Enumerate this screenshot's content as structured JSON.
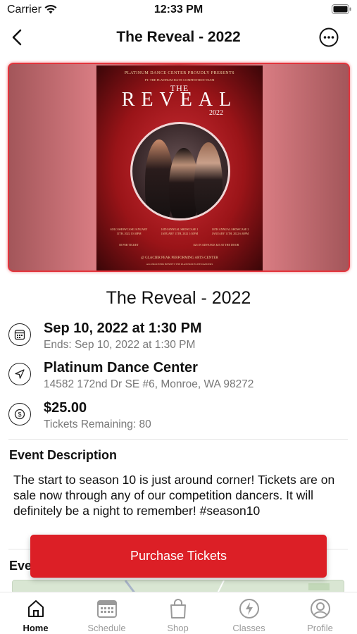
{
  "status_bar": {
    "carrier": "Carrier",
    "time": "12:33 PM"
  },
  "nav": {
    "title": "The Reveal - 2022"
  },
  "poster": {
    "header": "PLATINUM DANCE CENTER PROUDLY PRESENTS",
    "subheader": "PT. THE PLATINUM ELITE COMPETITION TEAM",
    "title_the": "THE",
    "title_main": "REVEAL",
    "title_year": "2022",
    "info_left": "SOLO SHOWCASE JANUARY 11TH, 2022 10:30PM",
    "info_center": "16TH ANNUAL SHOWCASE 1 JANUARY 11TH, 2022 1:30PM",
    "info_right": "16TH ANNUAL SHOWCASE 2 JANUARY 11TH, 2022 6:30PM",
    "info_price_left": "$5 PER TICKET",
    "info_price_right": "$25 IN ADVANCE $25 AT THE DOOR",
    "footer_main": "@ GLACIER PEAK PERFORMING ARTS CENTER",
    "footer_sub": "ALL PROCEEDS BENEFIT THE PLATINUM ELITE DANCERS"
  },
  "event": {
    "title": "The Reveal - 2022",
    "date_main": "Sep 10, 2022 at 1:30 PM",
    "date_sub": "Ends: Sep 10, 2022 at 1:30 PM",
    "location_main": "Platinum Dance Center",
    "location_sub": "14582 172nd Dr SE #6, Monroe, WA 98272",
    "price_main": "$25.00",
    "price_sub": "Tickets Remaining: 80"
  },
  "description": {
    "heading": "Event Description",
    "text": "The start to season 10 is just around corner!  Tickets are on sale now through any of our competition dancers.  It will definitely be a night to remember! #season10"
  },
  "partial_heading": "Eve",
  "purchase_button": {
    "label": "Purchase Tickets",
    "color": "#dc1f26"
  },
  "tabs": [
    {
      "label": "Home",
      "icon": "home-icon",
      "active": true
    },
    {
      "label": "Schedule",
      "icon": "calendar-icon",
      "active": false
    },
    {
      "label": "Shop",
      "icon": "shopping-bag-icon",
      "active": false
    },
    {
      "label": "Classes",
      "icon": "lightning-icon",
      "active": false
    },
    {
      "label": "Profile",
      "icon": "profile-icon",
      "active": false
    }
  ]
}
